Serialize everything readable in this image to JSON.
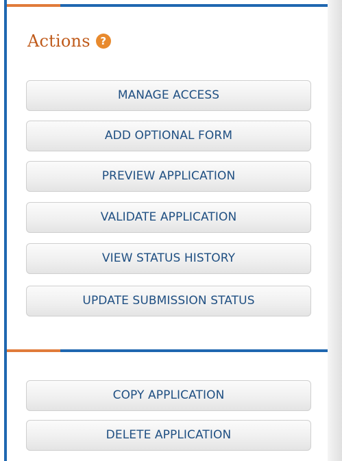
{
  "actions": {
    "title": "Actions",
    "help_icon_glyph": "?",
    "buttons": [
      "MANAGE ACCESS",
      "ADD OPTIONAL FORM",
      "PREVIEW APPLICATION",
      "VALIDATE APPLICATION",
      "VIEW STATUS HISTORY",
      "UPDATE SUBMISSION STATUS"
    ],
    "secondary_buttons": [
      "COPY APPLICATION",
      "DELETE APPLICATION"
    ]
  },
  "colors": {
    "accent_orange": "#e07b3a",
    "accent_blue": "#1f67b0",
    "title_text": "#bf5a1a",
    "button_text": "#1f4f82"
  },
  "icons": {
    "help": "help-icon"
  }
}
